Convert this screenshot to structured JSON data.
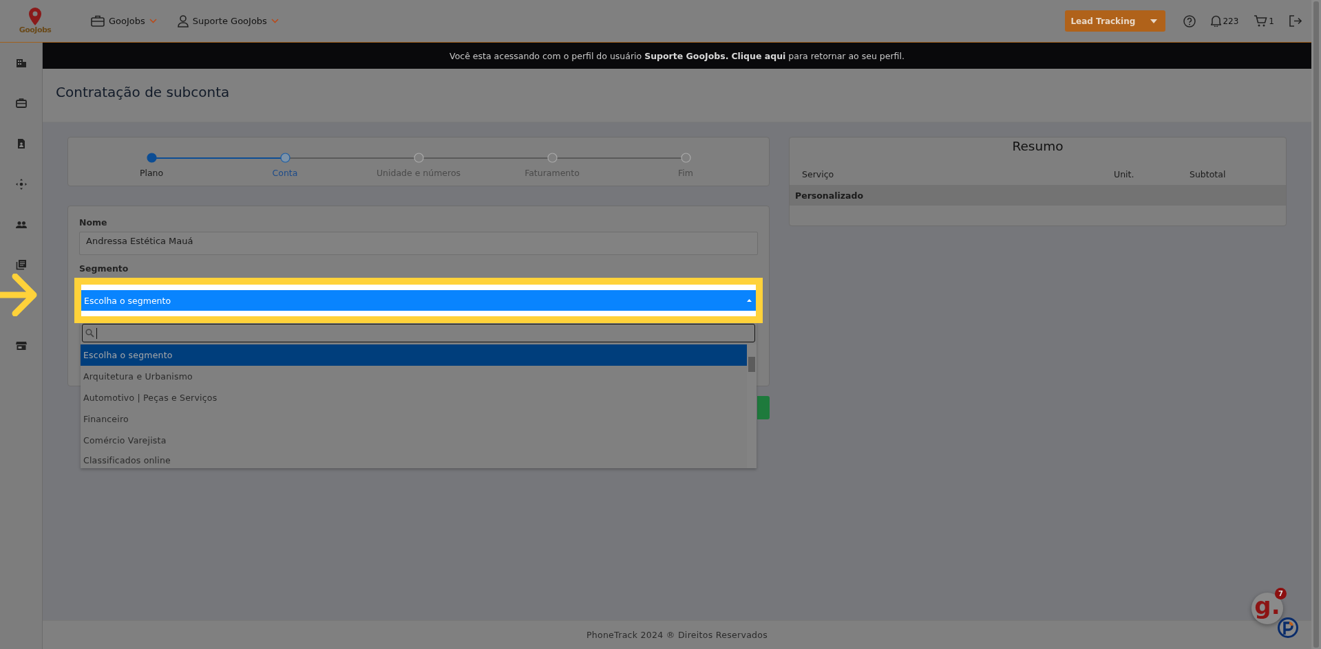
{
  "header": {
    "logo": "GooJobs",
    "menus": [
      {
        "label": "GooJobs"
      },
      {
        "label": "Suporte GooJobs"
      }
    ],
    "lead_button": "Lead Tracking",
    "notifications": "223",
    "cart": "1"
  },
  "banner": {
    "text": "Você esta acessando com o perfil do usuário **Suporte GooJobs.**",
    "link": "Clique aqui",
    "rest": "para retornar ao seu perfil."
  },
  "page_title": "Contratação de subconta",
  "steps": [
    {
      "label": "Plano",
      "done": true,
      "selected": false
    },
    {
      "label": "Conta",
      "done": false,
      "selected": true
    },
    {
      "label": "Unidade e números",
      "done": false,
      "selected": false
    },
    {
      "label": "Faturamento",
      "done": false,
      "selected": false
    },
    {
      "label": "Fim",
      "done": false,
      "selected": false
    }
  ],
  "form": {
    "name_label": "Nome",
    "name_value": "Andressa Estética Mauá",
    "segment_label": "Segmento",
    "segment_value": "Escolha o segmento",
    "options": [
      {
        "label": "Escolha o segmento",
        "selected": true
      },
      {
        "label": "Arquitetura e Urbanismo",
        "selected": false
      },
      {
        "label": "Automotivo | Peças e Serviços",
        "selected": false
      },
      {
        "label": "Financeiro",
        "selected": false
      },
      {
        "label": "Comércio Varejista",
        "selected": false
      },
      {
        "label": "Classificados online",
        "selected": false
      }
    ]
  },
  "summary": {
    "title": "Resumo",
    "columns": [
      "Serviço",
      "Unit.",
      "Subtotal"
    ],
    "rows": [
      {
        "cells": [
          "Personalizado"
        ]
      }
    ]
  },
  "footer": "PhoneTrack 2024 ® Direitos Reservados",
  "chat_widget": {
    "logo": "g.",
    "badge": "7"
  }
}
